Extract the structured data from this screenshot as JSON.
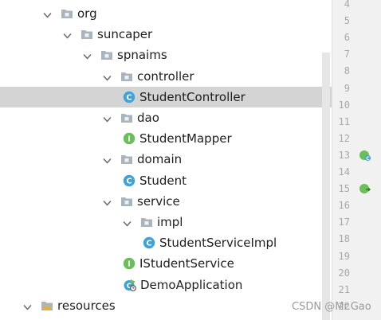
{
  "tree": [
    {
      "label": "org",
      "kind": "package",
      "expanded": true
    },
    {
      "label": "suncaper",
      "kind": "package",
      "expanded": true
    },
    {
      "label": "spnaims",
      "kind": "package",
      "expanded": true
    },
    {
      "label": "controller",
      "kind": "package",
      "expanded": true
    },
    {
      "label": "StudentController",
      "kind": "class",
      "selected": true
    },
    {
      "label": "dao",
      "kind": "package",
      "expanded": true
    },
    {
      "label": "StudentMapper",
      "kind": "interface"
    },
    {
      "label": "domain",
      "kind": "package",
      "expanded": true
    },
    {
      "label": "Student",
      "kind": "class"
    },
    {
      "label": "service",
      "kind": "package",
      "expanded": true
    },
    {
      "label": "impl",
      "kind": "package",
      "expanded": true
    },
    {
      "label": "StudentServiceImpl",
      "kind": "class"
    },
    {
      "label": "IStudentService",
      "kind": "interface"
    },
    {
      "label": "DemoApplication",
      "kind": "spring-boot-app"
    },
    {
      "label": "resources",
      "kind": "resources-folder",
      "expanded": true
    }
  ],
  "gutter": {
    "line_numbers": [
      "4",
      "5",
      "6",
      "7",
      "8",
      "9",
      "10",
      "11",
      "12",
      "13",
      "14",
      "15",
      "16",
      "17",
      "18",
      "19",
      "20",
      "21",
      "22"
    ],
    "markers": [
      {
        "line": "13",
        "icon": "spring-bean-icon"
      },
      {
        "line": "15",
        "icon": "spring-mapping-icon"
      }
    ]
  },
  "watermark": "CSDN @Mr.Gao",
  "colors": {
    "selection": "#d4d4d4",
    "class_icon": "#3fa3d8",
    "interface_icon": "#6bbf5a",
    "folder_icon": "#9aa7b0",
    "gutter_bg": "#f1f1f1"
  }
}
